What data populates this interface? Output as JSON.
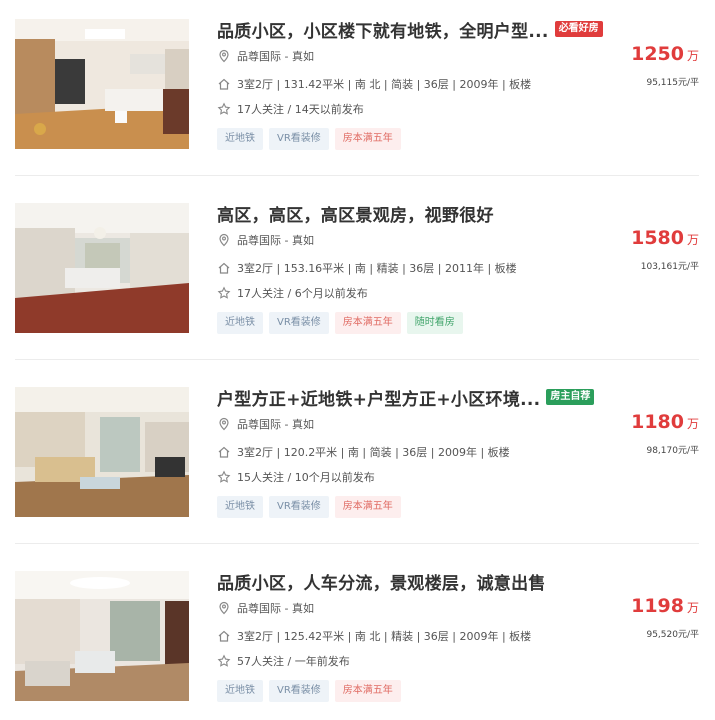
{
  "colors": {
    "accent": "#e03c3c",
    "tag_blue_bg": "#eef3f8",
    "tag_red_bg": "#fdeeee",
    "tag_green_bg": "#e8f6ee"
  },
  "listings": [
    {
      "title": "品质小区，小区楼下就有地铁，全明户型...",
      "badge": "必看好房",
      "badge_style": "red",
      "location": "品尊国际 - 真如",
      "details": "3室2厅 | 131.42平米 | 南 北 | 简装 | 36层 | 2009年 | 板楼",
      "follow": "17人关注 / 14天以前发布",
      "tags": [
        {
          "label": "近地铁",
          "style": "blue"
        },
        {
          "label": "VR看装修",
          "style": "blue"
        },
        {
          "label": "房本满五年",
          "style": "red"
        }
      ],
      "total_price": "1250",
      "price_unit": "万",
      "unit_price": "95,115元/平"
    },
    {
      "title": "高区，高区，高区景观房，视野很好",
      "badge": "",
      "badge_style": "",
      "location": "品尊国际 - 真如",
      "details": "3室2厅 | 153.16平米 | 南 | 精装 | 36层 | 2011年 | 板楼",
      "follow": "17人关注 / 6个月以前发布",
      "tags": [
        {
          "label": "近地铁",
          "style": "blue"
        },
        {
          "label": "VR看装修",
          "style": "blue"
        },
        {
          "label": "房本满五年",
          "style": "red"
        },
        {
          "label": "随时看房",
          "style": "green"
        }
      ],
      "total_price": "1580",
      "price_unit": "万",
      "unit_price": "103,161元/平"
    },
    {
      "title": "户型方正+近地铁+户型方正+小区环境...",
      "badge": "房主自荐",
      "badge_style": "green",
      "location": "品尊国际 - 真如",
      "details": "3室2厅 | 120.2平米 | 南 | 简装 | 36层 | 2009年 | 板楼",
      "follow": "15人关注 / 10个月以前发布",
      "tags": [
        {
          "label": "近地铁",
          "style": "blue"
        },
        {
          "label": "VR看装修",
          "style": "blue"
        },
        {
          "label": "房本满五年",
          "style": "red"
        }
      ],
      "total_price": "1180",
      "price_unit": "万",
      "unit_price": "98,170元/平"
    },
    {
      "title": "品质小区，人车分流，景观楼层，诚意出售",
      "badge": "",
      "badge_style": "",
      "location": "品尊国际 - 真如",
      "details": "3室2厅 | 125.42平米 | 南 北 | 精装 | 36层 | 2009年 | 板楼",
      "follow": "57人关注 / 一年前发布",
      "tags": [
        {
          "label": "近地铁",
          "style": "blue"
        },
        {
          "label": "VR看装修",
          "style": "blue"
        },
        {
          "label": "房本满五年",
          "style": "red"
        }
      ],
      "total_price": "1198",
      "price_unit": "万",
      "unit_price": "95,520元/平"
    }
  ]
}
